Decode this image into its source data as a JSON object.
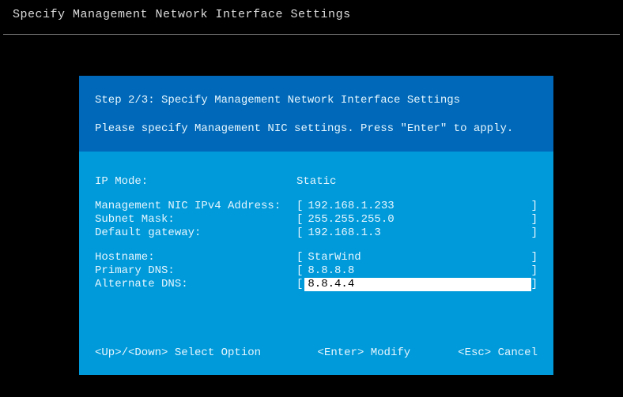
{
  "window": {
    "title": "Specify Management Network Interface Settings"
  },
  "header": {
    "step": "Step 2/3: Specify Management Network Interface Settings",
    "instruction": "Please specify Management NIC settings. Press \"Enter\" to apply."
  },
  "fields": {
    "ip_mode_label": "IP Mode:",
    "ip_mode_value": "Static",
    "mgmt_ip_label": "Management NIC IPv4 Address:",
    "mgmt_ip_value": "192.168.1.233",
    "subnet_label": "Subnet Mask:",
    "subnet_value": "255.255.255.0",
    "gateway_label": "Default gateway:",
    "gateway_value": "192.168.1.3",
    "hostname_label": "Hostname:",
    "hostname_value": "StarWind",
    "primary_dns_label": "Primary DNS:",
    "primary_dns_value": "8.8.8.8",
    "alternate_dns_label": "Alternate DNS:",
    "alternate_dns_value": "8.8.4.4"
  },
  "active_field": "alternate_dns",
  "hints": {
    "nav": "<Up>/<Down> Select Option",
    "modify": "<Enter> Modify",
    "cancel": "<Esc> Cancel"
  },
  "brackets": {
    "open": "[",
    "close": "]"
  }
}
